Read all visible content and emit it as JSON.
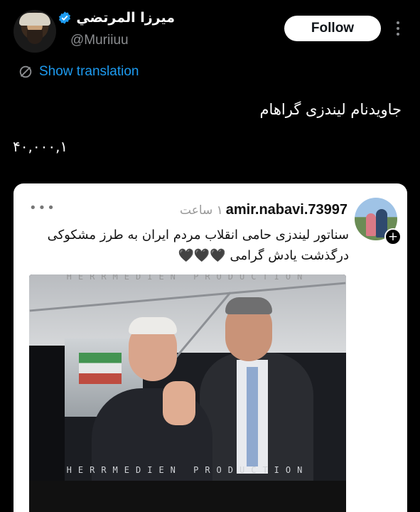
{
  "author": {
    "display_name": "ميرزا المرتضي",
    "handle": "@Muriiuu",
    "verified": true
  },
  "follow_label": "Follow",
  "translate_label": "Show translation",
  "tweet": {
    "text": "جاویدنام لیندزی گراهام",
    "number": "۴۰,۰۰۰,۱"
  },
  "quoted_card": {
    "username": "amir.nabavi.73997",
    "time": "۱ ساعت",
    "line1": "سناتور لیندزی حامی انقلاب مردم ایران به طرز مشکوکی",
    "line2": "درگذشت یادش گرامی 🖤🖤🖤",
    "watermark_top": "HERRMEDIEN PRODUCTION",
    "watermark_bottom": "HERRMEDIEN PRODUCTION"
  },
  "colors": {
    "accent": "#1d9bf0",
    "background": "#000000"
  }
}
